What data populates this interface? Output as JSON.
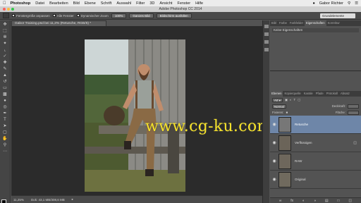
{
  "menubar": {
    "apple_icon": "apple-icon",
    "app": "Photoshop",
    "items": [
      "Datei",
      "Bearbeiten",
      "Bild",
      "Ebene",
      "Schrift",
      "Auswahl",
      "Filter",
      "3D",
      "Ansicht",
      "Fenster",
      "Hilfe"
    ],
    "user": "Gabor Richter"
  },
  "window": {
    "title": "Adobe Photoshop CC 2014"
  },
  "options": {
    "fit_windows": "Fenstergröße anpassen",
    "all_windows": "Alle Fenster",
    "scrubby_zoom": "Dynamischer Zoom",
    "zoom_100": "100%",
    "fit_screen": "Ganzes Bild",
    "fill_screen": "Bildschirm ausfüllen",
    "workspace": "Grundelemente"
  },
  "document": {
    "tab_label": "Gabor Training.psd bei 11,3% (Retusche, RGB/8) *",
    "zoom": "11,25%",
    "doc_size": "Dok: 43,1 MB/308,6 MB",
    "watermark": "www.cg-ku.com"
  },
  "panels": {
    "top_tabs": [
      "Bibl",
      "Farbe",
      "Farbfelder",
      "Eigenschaften",
      "Korrektur"
    ],
    "properties_empty": "Keine Eigenschaften",
    "layer_tabs": [
      "Ebenen",
      "Kopierquelle",
      "Kanäle",
      "Pfade",
      "Protokoll",
      "Absatz"
    ],
    "kind_label": "Art",
    "blend_mode": "Normal",
    "opacity_label": "Deckkraft:",
    "lock_label": "Fixieren:",
    "fill_label": "Fläche:",
    "layers": [
      {
        "name": "Retusche",
        "selected": true
      },
      {
        "name": "Verflüssigen",
        "selected": false
      },
      {
        "name": "RAW",
        "selected": false
      },
      {
        "name": "Original",
        "selected": false
      }
    ]
  },
  "colors": {
    "selected_layer": "#6e86a8",
    "watermark": "#f6e22a"
  }
}
